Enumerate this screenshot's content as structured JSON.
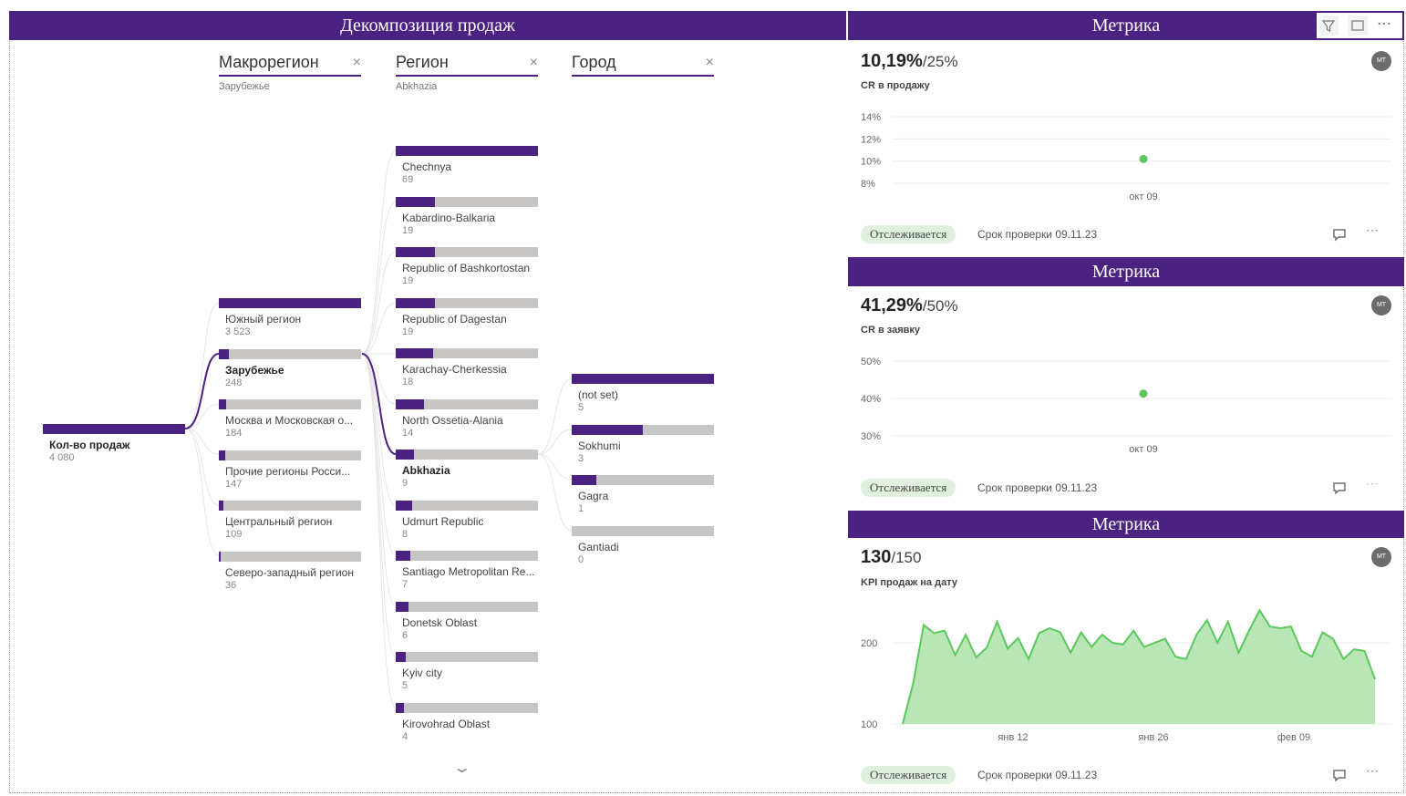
{
  "decomp": {
    "title": "Декомпозиция продаж",
    "root": {
      "label": "Кол-во продаж",
      "value": "4 080"
    },
    "columns": [
      {
        "header": "Макрорегион",
        "sub": "Зарубежье",
        "close": "×"
      },
      {
        "header": "Регион",
        "sub": "Abkhazia",
        "close": "×"
      },
      {
        "header": "Город",
        "sub": "",
        "close": "×"
      }
    ],
    "macro": [
      {
        "label": "Южный регион",
        "value": "3 523",
        "frac": 1.0
      },
      {
        "label": "Зарубежье",
        "value": "248",
        "frac": 0.07,
        "selected": true
      },
      {
        "label": "Москва и Московская о...",
        "value": "184",
        "frac": 0.052
      },
      {
        "label": "Прочие регионы Росси...",
        "value": "147",
        "frac": 0.042
      },
      {
        "label": "Центральный регион",
        "value": "109",
        "frac": 0.031
      },
      {
        "label": "Северо-западный регион",
        "value": "36",
        "frac": 0.01
      }
    ],
    "regions": [
      {
        "label": "Chechnya",
        "value": "69",
        "frac": 1.0
      },
      {
        "label": "Kabardino-Balkaria",
        "value": "19",
        "frac": 0.275
      },
      {
        "label": "Republic of Bashkortostan",
        "value": "19",
        "frac": 0.275
      },
      {
        "label": "Republic of Dagestan",
        "value": "19",
        "frac": 0.275
      },
      {
        "label": "Karachay-Cherkessia",
        "value": "18",
        "frac": 0.26
      },
      {
        "label": "North Ossetia-Alania",
        "value": "14",
        "frac": 0.2
      },
      {
        "label": "Abkhazia",
        "value": "9",
        "frac": 0.13,
        "selected": true
      },
      {
        "label": "Udmurt Republic",
        "value": "8",
        "frac": 0.116
      },
      {
        "label": "Santiago Metropolitan Re...",
        "value": "7",
        "frac": 0.1
      },
      {
        "label": "Donetsk Oblast",
        "value": "6",
        "frac": 0.087
      },
      {
        "label": "Kyiv city",
        "value": "5",
        "frac": 0.072
      },
      {
        "label": "Kirovohrad Oblast",
        "value": "4",
        "frac": 0.058
      }
    ],
    "cities": [
      {
        "label": "(not set)",
        "value": "5",
        "frac": 1.0
      },
      {
        "label": "Sokhumi",
        "value": "3",
        "frac": 0.5
      },
      {
        "label": "Gagra",
        "value": "1",
        "frac": 0.17
      },
      {
        "label": "Gantiadi",
        "value": "0",
        "frac": 0.0
      }
    ],
    "more_icon": "chevron-down-icon"
  },
  "toolbar": {
    "filter_icon": "filter-icon",
    "focus_icon": "focus-mode-icon",
    "more_icon": "more-options-icon"
  },
  "cards": [
    {
      "title": "Метрика",
      "value": "10,19%",
      "goal": "/25%",
      "name": "CR в продажу",
      "avatar": "MT",
      "status": "Отслеживается",
      "due": "Срок проверки 09.11.23",
      "chart_data": {
        "type": "scatter",
        "x": [
          "окт 09"
        ],
        "y": [
          10.19
        ],
        "yticks": [
          "14%",
          "12%",
          "10%",
          "8%"
        ],
        "ylim": [
          8,
          14
        ],
        "xticks": [
          "окт 09"
        ],
        "color": "#5bc85b"
      }
    },
    {
      "title": "Метрика",
      "value": "41,29%",
      "goal": "/50%",
      "name": "CR в заявку",
      "avatar": "MT",
      "status": "Отслеживается",
      "due": "Срок проверки 09.11.23",
      "chart_data": {
        "type": "scatter",
        "x": [
          "окт 09"
        ],
        "y": [
          41.29
        ],
        "yticks": [
          "50%",
          "40%",
          "30%"
        ],
        "ylim": [
          30,
          50
        ],
        "xticks": [
          "окт 09"
        ],
        "color": "#5bc85b"
      }
    },
    {
      "title": "Метрика",
      "value": "130",
      "goal": "/150",
      "name": "KPI продаж на дату",
      "avatar": "MT",
      "status": "Отслеживается",
      "due": "Срок проверки 09.11.23",
      "chart_data": {
        "type": "area",
        "y": [
          100,
          150,
          222,
          212,
          215,
          185,
          210,
          182,
          194,
          226,
          193,
          206,
          180,
          212,
          218,
          213,
          188,
          213,
          195,
          210,
          200,
          198,
          215,
          195,
          200,
          205,
          183,
          180,
          210,
          228,
          200,
          226,
          188,
          215,
          240,
          220,
          218,
          220,
          190,
          183,
          213,
          205,
          180,
          192,
          190,
          155
        ],
        "yticks": [
          "200",
          "100"
        ],
        "ylim": [
          100,
          245
        ],
        "xticks": [
          "янв 12",
          "янв 26",
          "фев 09"
        ],
        "color": "#5bc85b",
        "fill": "#b8e6b6"
      }
    }
  ]
}
